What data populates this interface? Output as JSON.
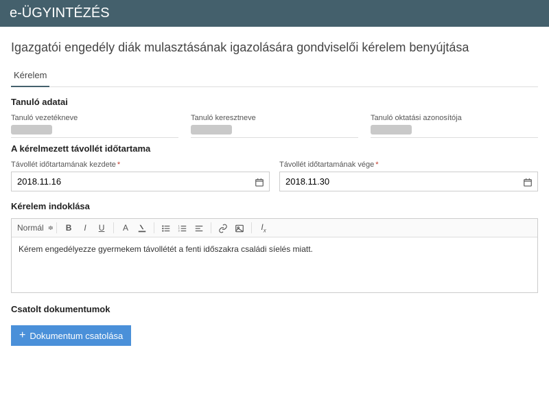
{
  "header": {
    "app_name": "e-ÜGYINTÉZÉS"
  },
  "page_title": "Igazgatói engedély diák mulasztásának igazolására gondviselői kérelem benyújtása",
  "tabs": [
    {
      "label": "Kérelem"
    }
  ],
  "sections": {
    "student": {
      "title": "Tanuló adatai",
      "fields": {
        "lastname": {
          "label": "Tanuló vezetékneve"
        },
        "firstname": {
          "label": "Tanuló keresztneve"
        },
        "edu_id": {
          "label": "Tanuló oktatási azonosítója"
        }
      }
    },
    "absence": {
      "title": "A kérelmezett távollét időtartama",
      "start": {
        "label": "Távollét időtartamának kezdete",
        "required": "*",
        "value": "2018.11.16"
      },
      "end": {
        "label": "Távollét időtartamának vége",
        "required": "*",
        "value": "2018.11.30"
      }
    },
    "reason": {
      "title": "Kérelem indoklása",
      "editor": {
        "format_label": "Normál",
        "body": "Kérem engedélyezze gyermekem távollétét a fenti időszakra családi síelés miatt."
      }
    },
    "attachments": {
      "title": "Csatolt dokumentumok",
      "button_label": "Dokumentum csatolása"
    }
  }
}
